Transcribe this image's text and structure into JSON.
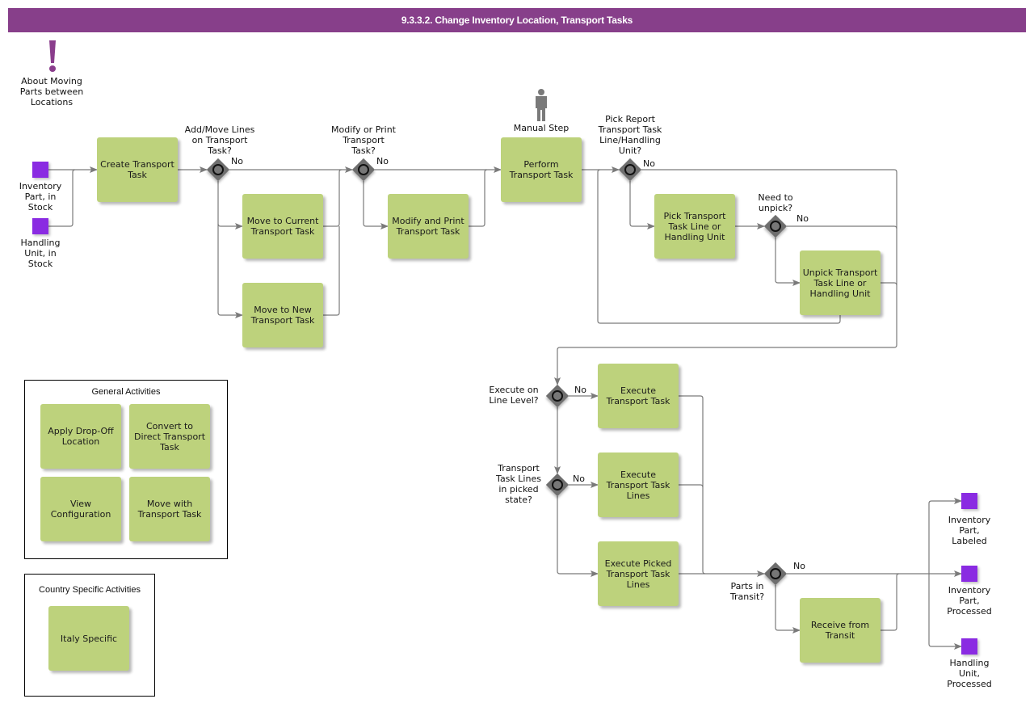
{
  "header": {
    "title": "9.3.3.2. Change Inventory Location, Transport Tasks"
  },
  "colors": {
    "title_bar": "#873f8a",
    "task": "#bdd27c",
    "event": "#8a2be2",
    "gateway": "#6e6e6e",
    "connector": "#7a7a7a"
  },
  "annotation": {
    "icon": "exclamation-icon",
    "label": "About Moving\nParts between\nLocations"
  },
  "manual_step": {
    "icon": "person-icon",
    "label": "Manual Step"
  },
  "start_events": [
    {
      "label": "Inventory\nPart, in\nStock"
    },
    {
      "label": "Handling\nUnit, in\nStock"
    }
  ],
  "end_events": [
    {
      "label": "Inventory\nPart,\nLabeled"
    },
    {
      "label": "Inventory\nPart,\nProcessed"
    },
    {
      "label": "Handling\nUnit,\nProcessed"
    }
  ],
  "tasks": {
    "create": "Create Transport Task",
    "move_current": "Move to Current Transport Task",
    "move_new": "Move to New Transport Task",
    "modify_print": "Modify and Print Transport Task",
    "perform": "Perform Transport Task",
    "pick": "Pick Transport Task Line or Handling Unit",
    "unpick": "Unpick Transport Task Line or Handling Unit",
    "execute": "Execute Transport Task",
    "execute_lines": "Execute Transport Task Lines",
    "execute_picked": "Execute Picked Transport Task Lines",
    "receive": "Receive from Transit"
  },
  "gateways": {
    "add_move": "Add/Move Lines\non Transport\nTask?",
    "modify_print": "Modify or Print\nTransport\nTask?",
    "pick_report": "Pick Report\nTransport Task\nLine/Handling\nUnit?",
    "unpick": "Need to\nunpick?",
    "line_level": "Execute on\nLine Level?",
    "picked_state": "Transport\nTask Lines\nin picked\nstate?",
    "in_transit": "Parts in\nTransit?"
  },
  "edge_labels": {
    "no": "No"
  },
  "groups": {
    "general": {
      "title": "General Activities",
      "items": [
        "Apply Drop-Off Location",
        "Convert to Direct Transport Task",
        "View Configuration",
        "Move with Transport Task"
      ]
    },
    "country": {
      "title": "Country Specific Activities",
      "items": [
        "Italy Specific"
      ]
    }
  }
}
